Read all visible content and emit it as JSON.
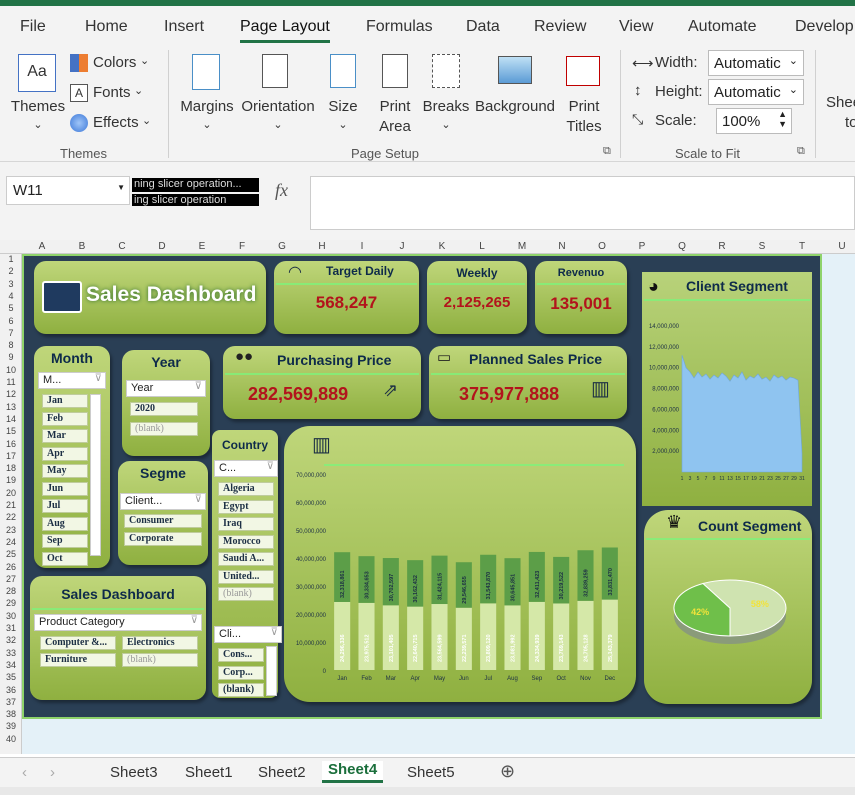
{
  "ribbon_tabs": [
    "File",
    "Home",
    "Insert",
    "Page Layout",
    "Formulas",
    "Data",
    "Review",
    "View",
    "Automate",
    "Develop"
  ],
  "ribbon": {
    "themes": "Themes",
    "colors": "Colors",
    "fonts": "Fonts",
    "effects": "Effects",
    "margins": "Margins",
    "orientation": "Orientation",
    "size": "Size",
    "print_area_1": "Print",
    "print_area_2": "Area",
    "breaks": "Breaks",
    "background": "Background",
    "print_titles_1": "Print",
    "print_titles_2": "Titles",
    "width_label": "Width:",
    "width_value": "Automatic",
    "height_label": "Height:",
    "height_value": "Automatic",
    "scale_label": "Scale:",
    "scale_value": "100%",
    "sheet_1": "Shee",
    "sheet_2": "to",
    "group_themes": "Themes",
    "group_page_setup": "Page Setup",
    "group_scale": "Scale to Fit"
  },
  "formula_bar": {
    "name_box": "W11",
    "tooltip_1": "ning slicer operation...",
    "tooltip_2": "ing slicer operation",
    "fx": "fx"
  },
  "columns": [
    "A",
    "B",
    "C",
    "D",
    "E",
    "F",
    "G",
    "H",
    "I",
    "J",
    "K",
    "L",
    "M",
    "N",
    "O",
    "P",
    "Q",
    "R",
    "S",
    "T",
    "U"
  ],
  "rows": [
    "1",
    "2",
    "3",
    "4",
    "5",
    "6",
    "7",
    "8",
    "9",
    "10",
    "11",
    "12",
    "13",
    "14",
    "15",
    "16",
    "17",
    "18",
    "19",
    "20",
    "21",
    "22",
    "23",
    "24",
    "25",
    "26",
    "27",
    "28",
    "29",
    "30",
    "31",
    "32",
    "33",
    "34",
    "35",
    "36",
    "37",
    "38",
    "39",
    "40"
  ],
  "dashboard": {
    "title": "Sales Dashboard",
    "target_daily_label": "Target Daily",
    "target_daily_value": "568,247",
    "weekly_label": "Weekly",
    "weekly_value": "2,125,265",
    "revenue_label": "Revenuo",
    "revenue_value": "135,001",
    "purchasing_label": "Purchasing Price",
    "purchasing_value": "282,569,889",
    "planned_label": "Planned Sales Price",
    "planned_value": "375,977,888",
    "client_segment_title": "Client Segment",
    "count_segment_title": "Count Segment",
    "sales_dashboard_2": "Sales Dashboard"
  },
  "slicers": {
    "month": {
      "title": "Month",
      "header": "M...",
      "items": [
        "Jan",
        "Feb",
        "Mar",
        "Apr",
        "May",
        "Jun",
        "Jul",
        "Aug",
        "Sep",
        "Oct"
      ]
    },
    "year": {
      "title": "Year",
      "header": "Year",
      "items": [
        "2020",
        "(blank)"
      ]
    },
    "segment": {
      "title": "Segme",
      "header": "Client...",
      "items": [
        "Consumer",
        "Corporate"
      ]
    },
    "country": {
      "title": "Country",
      "header": "C...",
      "items": [
        "Algeria",
        "Egypt",
        "Iraq",
        "Morocco",
        "Saudi A...",
        "United...",
        "(blank)"
      ]
    },
    "client": {
      "header": "Cli...",
      "items": [
        "Cons...",
        "Corp...",
        "(blank)"
      ]
    },
    "product": {
      "header": "Product Category",
      "items": [
        "Computer &...",
        "Electronics",
        "Furniture",
        "(blank)"
      ]
    }
  },
  "sheet_tabs": [
    "Sheet3",
    "Sheet1",
    "Sheet2",
    "Sheet4",
    "Sheet5"
  ],
  "active_sheet": "Sheet4",
  "colors": {
    "excel_green": "#217346",
    "dash_bg": "#2a3f55",
    "card": "#a9c45a",
    "kpi_red": "#b2141c"
  },
  "chart_data": [
    {
      "type": "bar",
      "categories": [
        "Jan",
        "Feb",
        "Mar",
        "Apr",
        "May",
        "Jun",
        "Jul",
        "Aug",
        "Sep",
        "Oct",
        "Nov",
        "Dec"
      ],
      "series": [
        {
          "values": [
            24296336,
            23975512,
            23101405,
            22640715,
            23564599,
            22239571,
            23809120,
            23081992,
            24334939,
            23769143,
            24705128,
            25143379
          ]
        },
        {
          "values": [
            32318861,
            30334653,
            30702597,
            30162432,
            31424115,
            29546655,
            31543870,
            30645851,
            32411423,
            30219522,
            32839259,
            33831470
          ]
        }
      ],
      "y_ticks": [
        "0",
        "10,000,000",
        "20,000,000",
        "30,000,000",
        "40,000,000",
        "50,000,000",
        "60,000,000",
        "70,000,000"
      ],
      "ylim": [
        0,
        70000000
      ],
      "stacked": true
    },
    {
      "type": "area",
      "title": "Client Segment",
      "x_ticks": [
        "1",
        "3",
        "5",
        "7",
        "9",
        "11",
        "13",
        "15",
        "17",
        "19",
        "21",
        "23",
        "25",
        "27",
        "29",
        "31"
      ],
      "y_ticks": [
        "2,000,000",
        "4,000,000",
        "6,000,000",
        "8,000,000",
        "10,000,000",
        "12,000,000",
        "14,000,000"
      ],
      "ylim": [
        0,
        14000000
      ],
      "x": [
        1,
        2,
        3,
        4,
        5,
        6,
        7,
        8,
        9,
        10,
        11,
        12,
        13,
        14,
        15,
        16,
        17,
        18,
        19,
        20,
        21,
        22,
        23,
        24,
        25,
        26,
        27,
        28,
        29,
        30,
        31
      ],
      "values": [
        11200000,
        10000000,
        9600000,
        9000000,
        9600000,
        9100000,
        9400000,
        8900000,
        9300000,
        9000000,
        9500000,
        9200000,
        8700000,
        9300000,
        9000000,
        9600000,
        8800000,
        9200000,
        9000000,
        9400000,
        8900000,
        9100000,
        8700000,
        9300000,
        9000000,
        9200000,
        8800000,
        9100000,
        9000000,
        8800000,
        1800000
      ]
    },
    {
      "type": "pie",
      "title": "Count Segment",
      "labels": [
        "42%",
        "58%"
      ],
      "values": [
        42,
        58
      ]
    }
  ]
}
